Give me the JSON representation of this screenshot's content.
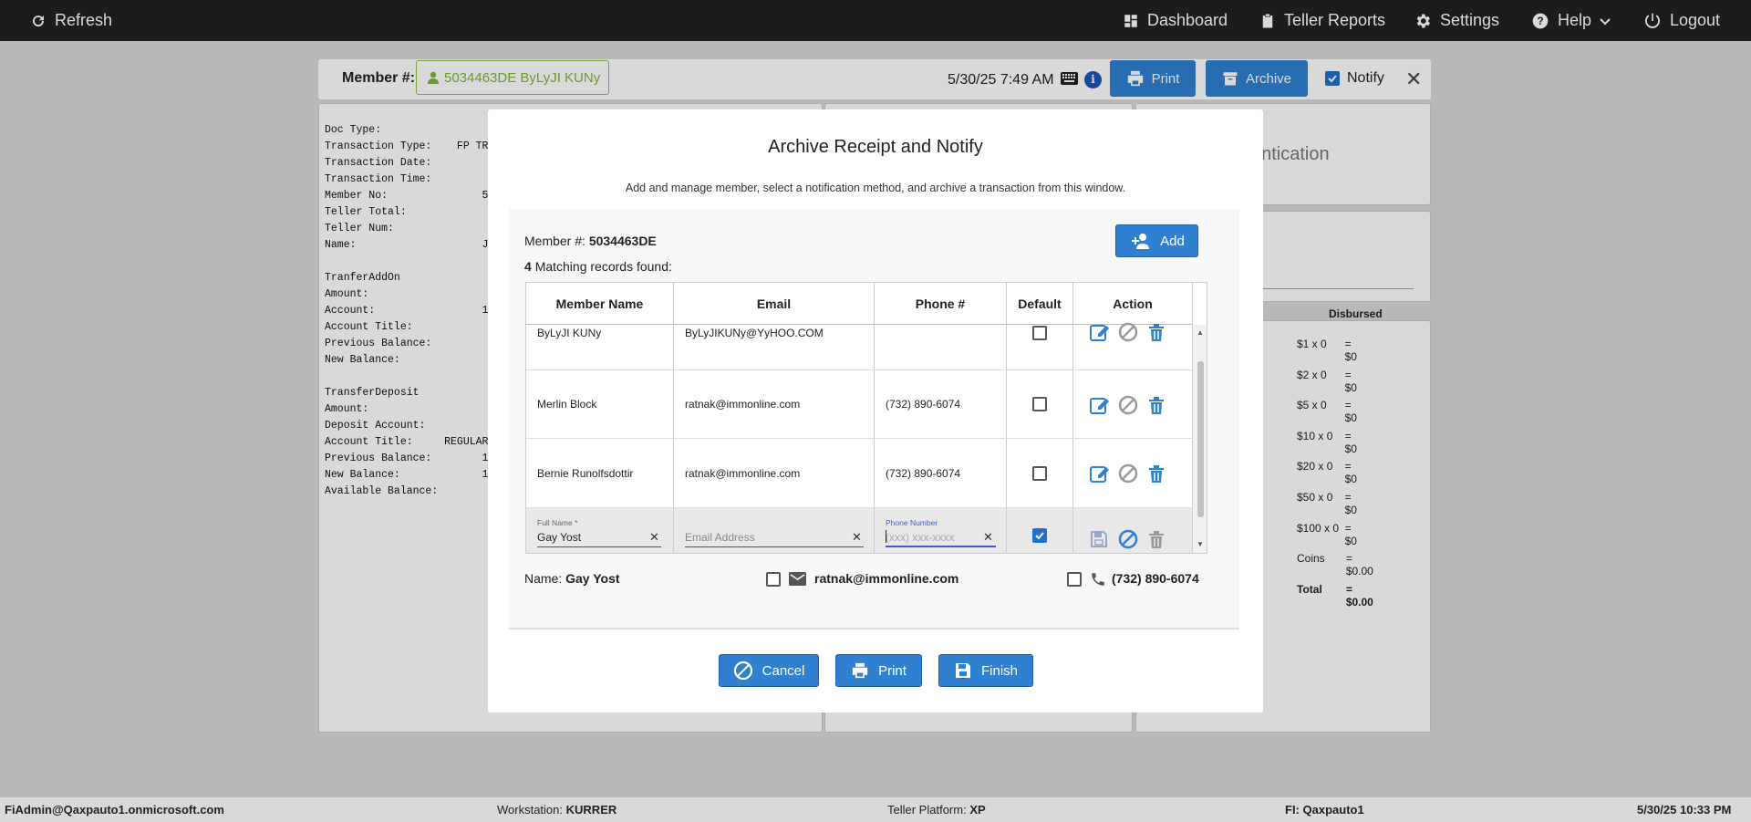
{
  "topbar": {
    "refresh": "Refresh",
    "dashboard": "Dashboard",
    "teller_reports": "Teller Reports",
    "settings": "Settings",
    "help": "Help",
    "logout": "Logout"
  },
  "member_bar": {
    "label": "Member #:",
    "chip": "5034463DE ByLyJI KUNy",
    "datetime": "5/30/25 7:49 AM",
    "print": "Print",
    "archive": "Archive",
    "notify": "Notify"
  },
  "receipt_lines": [
    "Doc Type:",
    "Transaction Type:    FP TRA",
    "Transaction Date:",
    "Transaction Time:",
    "Member No:               5",
    "Teller Total:",
    "Teller Num:",
    "Name:                    Ja",
    "",
    "TranferAddOn",
    "Amount:",
    "Account:                 1",
    "Account Title:",
    "Previous Balance:",
    "New Balance:",
    "",
    "TransferDeposit",
    "Amount:",
    "Deposit Account:",
    "Account Title:     REGULAR",
    "Previous Balance:        1",
    "New Balance:             1",
    "Available Balance:"
  ],
  "auth_panel_text": "entication",
  "cash": {
    "header": "Disbursed",
    "rows": [
      {
        "d": "$1 x 0",
        "v": "= $0"
      },
      {
        "d": "$2 x 0",
        "v": "= $0"
      },
      {
        "d": "$5 x 0",
        "v": "= $0"
      },
      {
        "d": "$10 x 0",
        "v": "= $0"
      },
      {
        "d": "$20 x 0",
        "v": "= $0"
      },
      {
        "d": "$50 x 0",
        "v": "= $0"
      },
      {
        "d": "$100 x 0",
        "v": "= $0"
      },
      {
        "d": "Coins",
        "v": "= $0.00"
      },
      {
        "d": "Total",
        "v": "= $0.00"
      }
    ]
  },
  "modal": {
    "title": "Archive Receipt and Notify",
    "description": "Add and manage member, select a notification method, and archive a transaction from this window.",
    "member_label": "Member #:",
    "member_number": "5034463DE",
    "match_count": "4",
    "match_text": "Matching records found:",
    "add": "Add",
    "columns": [
      "Member Name",
      "Email",
      "Phone #",
      "Default",
      "Action"
    ],
    "rows": [
      {
        "name": "ByLyJI KUNy",
        "email": "ByLyJIKUNy@YyHOO.COM",
        "phone": ""
      },
      {
        "name": "Merlin Block",
        "email": "ratnak@immonline.com",
        "phone": "(732) 890-6074"
      },
      {
        "name": "Bernie Runolfsdottir",
        "email": "ratnak@immonline.com",
        "phone": "(732) 890-6074"
      }
    ],
    "edit_row": {
      "fullname_label": "Full Name *",
      "fullname_value": "Gay Yost",
      "email_placeholder": "Email Address",
      "phone_label": "Phone Number",
      "phone_placeholder": "(xxx) xxx-xxxx"
    },
    "selection": {
      "name_label": "Name:",
      "name_value": "Gay Yost",
      "email": "ratnak@immonline.com",
      "phone": "(732) 890-6074"
    },
    "buttons": {
      "cancel": "Cancel",
      "print": "Print",
      "finish": "Finish"
    }
  },
  "footer": {
    "user": "FiAdmin@Qaxpauto1.onmicrosoft.com",
    "workstation_label": "Workstation:",
    "workstation": "KURRER",
    "platform_label": "Teller Platform:",
    "platform": "XP",
    "fi_label": "FI:",
    "fi": "Qaxpauto1",
    "datetime": "5/30/25 10:33 PM"
  }
}
